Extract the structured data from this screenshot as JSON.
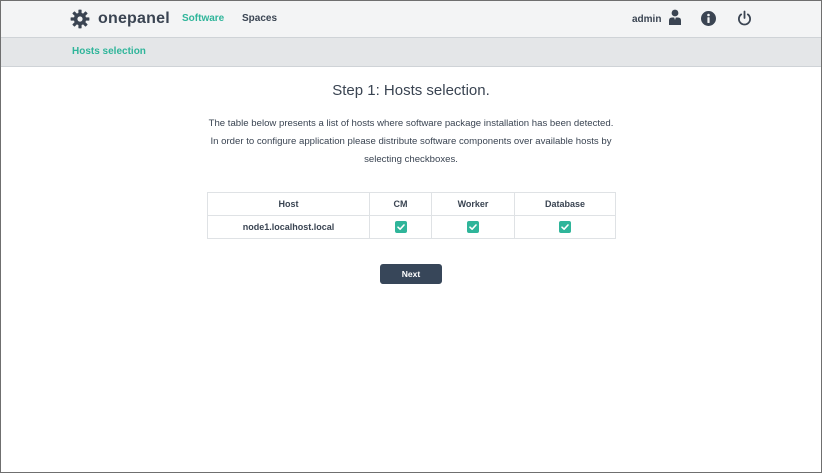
{
  "brand": {
    "name": "onepanel",
    "icon": "gear-icon"
  },
  "nav": [
    {
      "label": "Software",
      "active": true
    },
    {
      "label": "Spaces",
      "active": false
    }
  ],
  "user": {
    "name": "admin",
    "icon": "user-icon"
  },
  "header_icons": [
    "info-icon",
    "power-icon"
  ],
  "breadcrumb": {
    "label": "Hosts selection"
  },
  "main": {
    "title": "Step 1: Hosts selection.",
    "description_lines": [
      "The table below presents a list of hosts where software package installation has been detected.",
      "In order to configure application please distribute software components over available hosts by",
      "selecting checkboxes."
    ]
  },
  "table": {
    "columns": [
      "Host",
      "CM",
      "Worker",
      "Database"
    ],
    "rows": [
      {
        "host": "node1.localhost.local",
        "cm": true,
        "worker": true,
        "database": true
      }
    ]
  },
  "next_button": {
    "label": "Next"
  },
  "colors": {
    "accent": "#2fb59a",
    "dark": "#374659",
    "text": "#3a4452"
  }
}
